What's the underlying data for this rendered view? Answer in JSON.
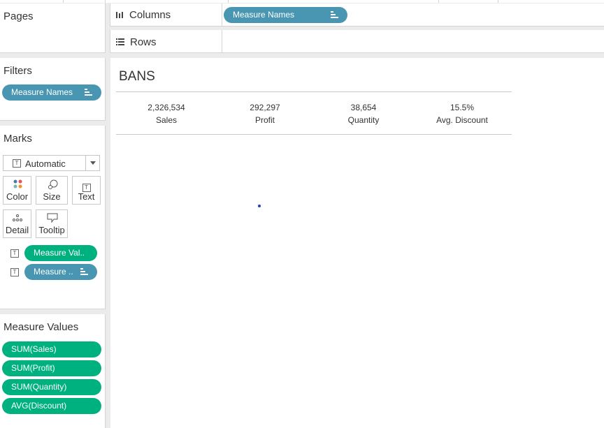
{
  "pages": {
    "title": "Pages"
  },
  "columns": {
    "label": "Columns",
    "pill": "Measure Names"
  },
  "rows": {
    "label": "Rows"
  },
  "filters": {
    "title": "Filters",
    "pill": "Measure Names"
  },
  "marks": {
    "title": "Marks",
    "mark_type": "Automatic",
    "buttons": {
      "color": "Color",
      "size": "Size",
      "text": "Text",
      "detail": "Detail",
      "tooltip": "Tooltip"
    },
    "pills": {
      "text": "Measure Val..",
      "label": "Measure .."
    }
  },
  "measure_values": {
    "title": "Measure Values",
    "items": [
      "SUM(Sales)",
      "SUM(Profit)",
      "SUM(Quantity)",
      "AVG(Discount)"
    ]
  },
  "view": {
    "title": "BANS",
    "kpis": [
      {
        "value": "2,326,534",
        "label": "Sales"
      },
      {
        "value": "292,297",
        "label": "Profit"
      },
      {
        "value": "38,654",
        "label": "Quantity"
      },
      {
        "value": "15.5%",
        "label": "Avg. Discount"
      }
    ]
  },
  "colors": {
    "blue_pill": "#4996b2",
    "green_pill": "#00b180",
    "panel_bg": "#ffffff",
    "app_bg": "#ebebeb"
  }
}
